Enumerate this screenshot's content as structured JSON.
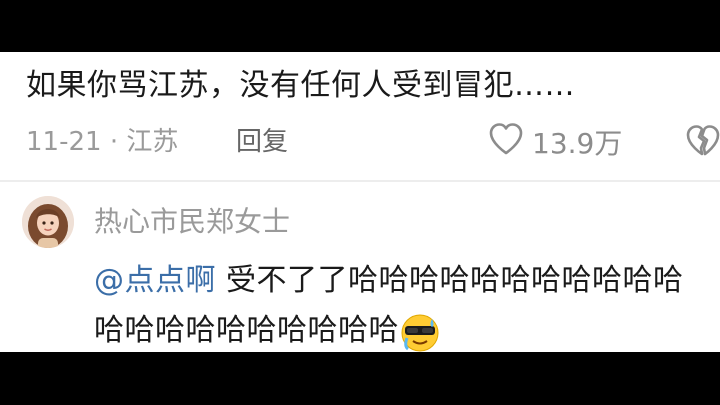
{
  "comment": {
    "text": "如果你骂江苏，没有任何人受到冒犯……",
    "date": "11-21",
    "separator": "·",
    "location": "江苏",
    "reply_label": "回复",
    "like_count": "13.9万"
  },
  "reply": {
    "username": "热心市民郑女士",
    "mention": "@点点啊",
    "text": " 受不了了哈哈哈哈哈哈哈哈哈哈哈哈哈哈哈哈哈哈哈哈哈",
    "emoji": "cool-face-sweat-emoji"
  },
  "colors": {
    "mention": "#3b6ea8",
    "meta": "#9a9a9a",
    "text": "#1a1a1a"
  }
}
